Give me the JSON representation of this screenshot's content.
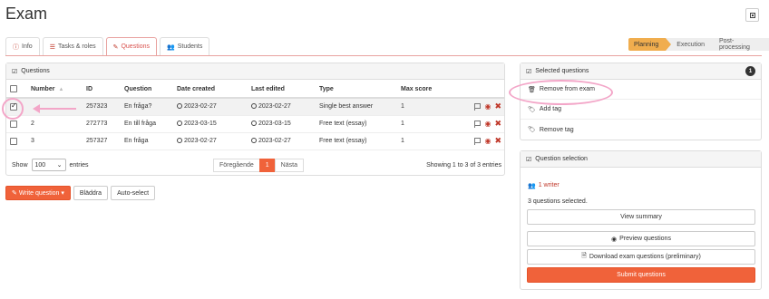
{
  "page": {
    "title": "Exam"
  },
  "tabs": [
    {
      "label": "Info",
      "icon": "info-circle-icon",
      "active": false
    },
    {
      "label": "Tasks & roles",
      "icon": "list-icon",
      "active": false
    },
    {
      "label": "Questions",
      "icon": "edit-icon",
      "active": true
    },
    {
      "label": "Students",
      "icon": "users-icon",
      "active": false
    }
  ],
  "steps": [
    "Planning",
    "Execution",
    "Post-processing"
  ],
  "questions_panel": {
    "title": "Questions",
    "columns": [
      "Number",
      "ID",
      "Question",
      "Date created",
      "Last edited",
      "Type",
      "Max score"
    ],
    "rows": [
      {
        "checked": true,
        "number": "1",
        "id": "257323",
        "question": "En fråga?",
        "created": "2023-02-27",
        "edited": "2023-02-27",
        "type": "Single best answer",
        "max": "1"
      },
      {
        "checked": false,
        "number": "2",
        "id": "272773",
        "question": "En till fråga",
        "created": "2023-03-15",
        "edited": "2023-03-15",
        "type": "Free text (essay)",
        "max": "1"
      },
      {
        "checked": false,
        "number": "3",
        "id": "257327",
        "question": "En fråga",
        "created": "2023-02-27",
        "edited": "2023-02-27",
        "type": "Free text (essay)",
        "max": "1"
      }
    ],
    "show_label": "Show",
    "show_value": "100",
    "entries_label": "entries",
    "prev": "Föregående",
    "page": "1",
    "next": "Nästa",
    "showing": "Showing 1 to 3 of 3 entries"
  },
  "actions": {
    "write": "Write question",
    "browse": "Bläddra",
    "auto": "Auto-select"
  },
  "selected_panel": {
    "title": "Selected questions",
    "count": "1",
    "items": [
      "Remove from exam",
      "Add tag",
      "Remove tag"
    ]
  },
  "selection_panel": {
    "title": "Question selection",
    "writers": "1 writer",
    "selected_text": "3 questions selected.",
    "view_summary": "View summary",
    "preview": "Preview questions",
    "download": "Download exam questions (preliminary)",
    "submit": "Submit questions"
  },
  "colors": {
    "accent": "#f0623a",
    "link": "#c0392b",
    "step_active": "#f0ad4e",
    "annotation": "#f3a6c8"
  }
}
